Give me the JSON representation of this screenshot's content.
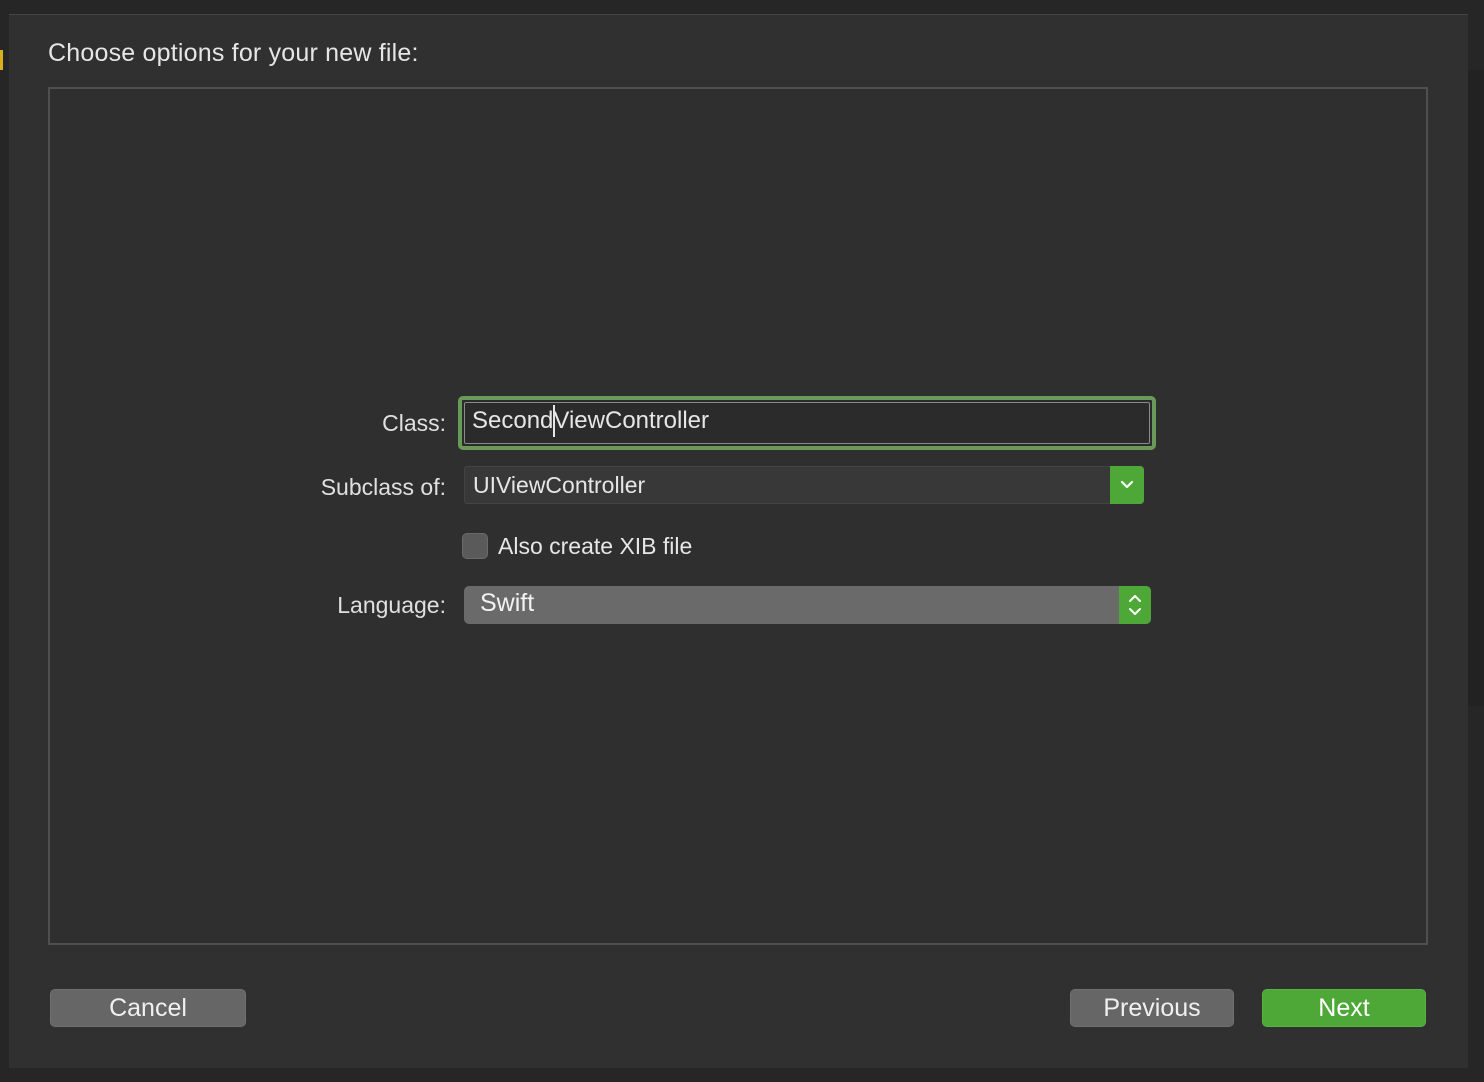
{
  "dialog": {
    "title": "Choose options for your new file:"
  },
  "form": {
    "class_label": "Class:",
    "class_value": "SecondViewController",
    "subclass_label": "Subclass of:",
    "subclass_value": "UIViewController",
    "xib_label": "Also create XIB file",
    "xib_checked": false,
    "language_label": "Language:",
    "language_value": "Swift"
  },
  "buttons": {
    "cancel": "Cancel",
    "previous": "Previous",
    "next": "Next"
  },
  "colors": {
    "accent": "#4ea838",
    "focus_ring": "#6a9a5a",
    "sheet_bg": "#303030"
  },
  "icons": {
    "combo_arrow": "chevron-down-icon",
    "popup_arrows": "up-down-chevrons-icon"
  }
}
